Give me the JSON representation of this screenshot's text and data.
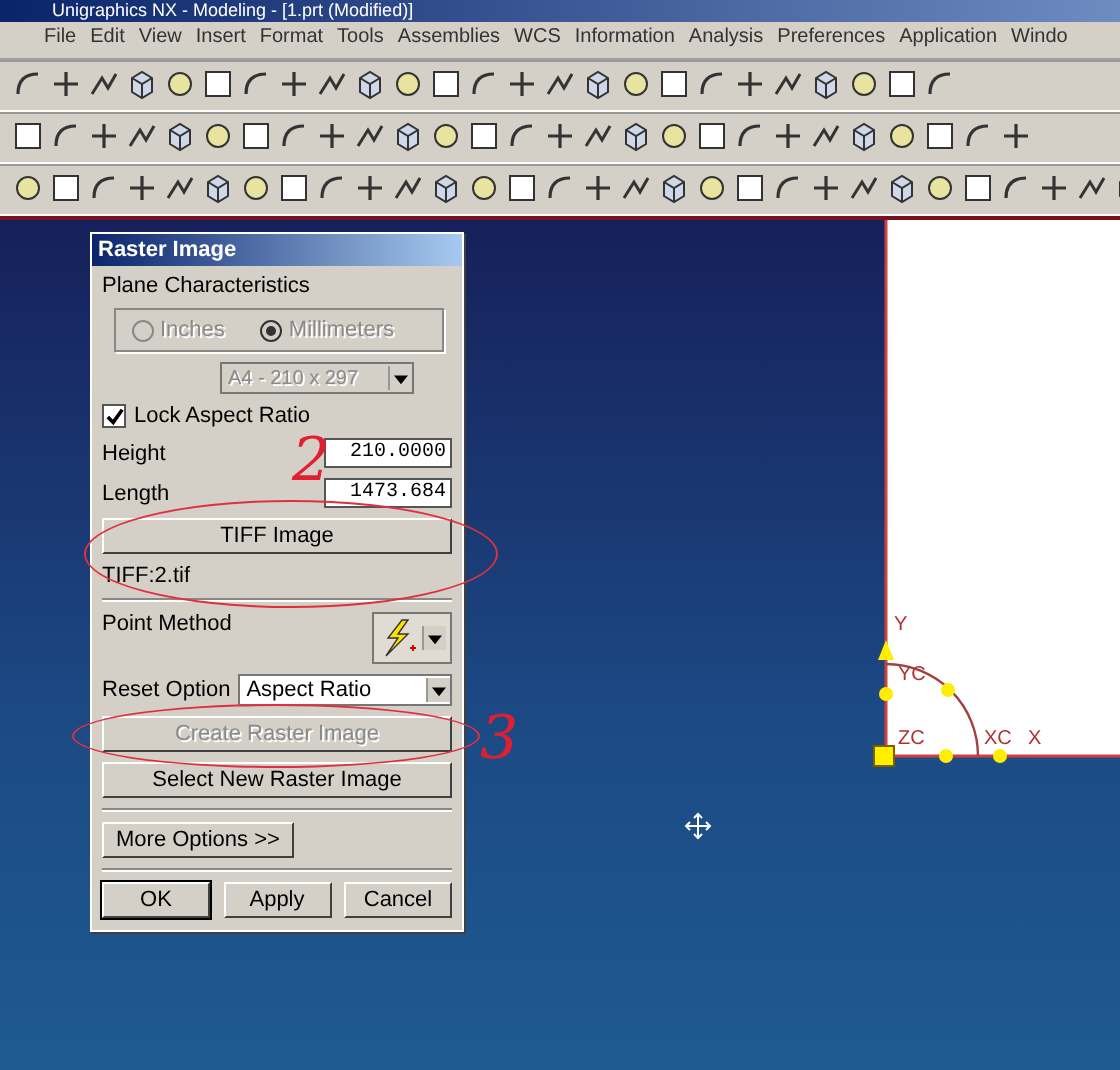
{
  "window": {
    "title": "Unigraphics NX - Modeling - [1.prt (Modified)]"
  },
  "menu": [
    "File",
    "Edit",
    "View",
    "Insert",
    "Format",
    "Tools",
    "Assemblies",
    "WCS",
    "Information",
    "Analysis",
    "Preferences",
    "Application",
    "Windo"
  ],
  "dialog": {
    "title": "Raster Image",
    "section": "Plane Characteristics",
    "units": [
      {
        "label": "Inches",
        "selected": false,
        "disabled": true
      },
      {
        "label": "Millimeters",
        "selected": true,
        "disabled": true
      }
    ],
    "paper": {
      "value": "A4 - 210 x 297",
      "disabled": true
    },
    "lock": {
      "label": "Lock Aspect Ratio",
      "checked": true
    },
    "fields": [
      {
        "label": "Height",
        "value": "210.0000"
      },
      {
        "label": "Length",
        "value": "1473.684"
      }
    ],
    "image_button": "TIFF Image",
    "file": "TIFF:2.tif",
    "point_method": "Point Method",
    "reset": {
      "label": "Reset Option",
      "value": "Aspect Ratio"
    },
    "actions": [
      {
        "label": "Create Raster Image",
        "disabled": true
      },
      {
        "label": "Select New Raster Image",
        "disabled": false
      }
    ],
    "more": "More Options >>",
    "footer": [
      "OK",
      "Apply",
      "Cancel"
    ]
  },
  "annotations": [
    "2",
    "3"
  ],
  "viewport": {
    "labels": [
      "Y",
      "YC",
      "ZC",
      "XC",
      "X"
    ]
  }
}
